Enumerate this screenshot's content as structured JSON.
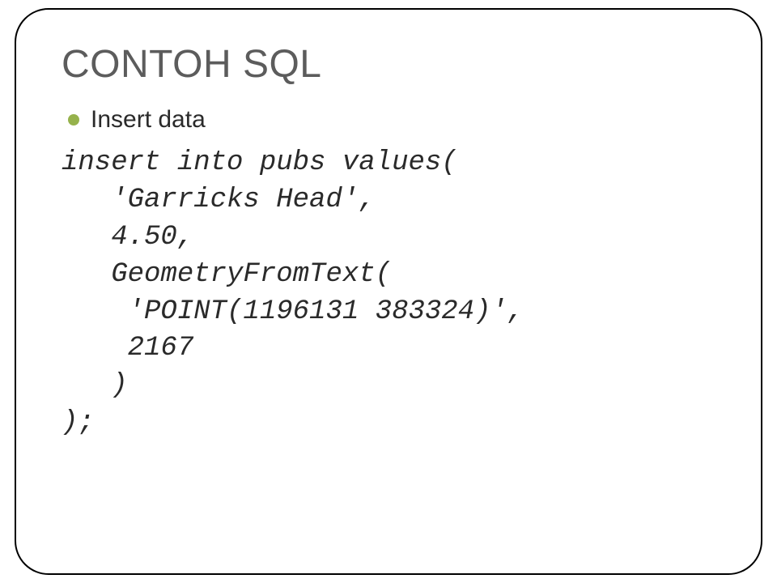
{
  "title": "CONTOH SQL",
  "bullet": {
    "text": "Insert data"
  },
  "code": {
    "line1": "insert into pubs values(",
    "line2": "   'Garricks Head',",
    "line3": "   4.50,",
    "line4": "   GeometryFromText(",
    "line5": "    'POINT(1196131 383324)',",
    "line6": "    2167",
    "line7": "   )",
    "line8": ");"
  }
}
